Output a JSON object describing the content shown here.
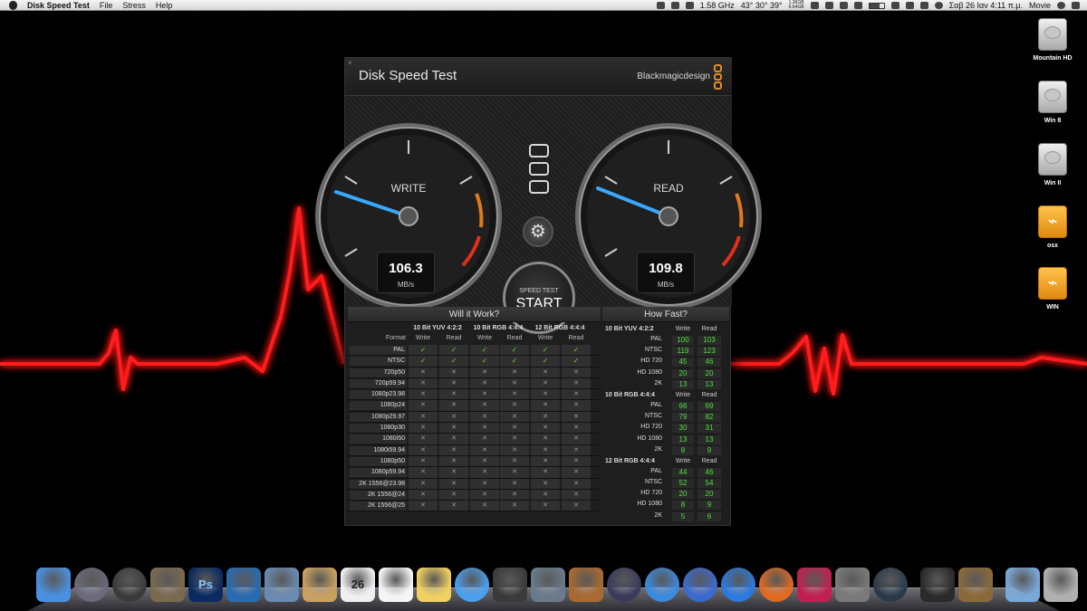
{
  "menubar": {
    "app_name": "Disk Speed Test",
    "menus": [
      "File",
      "Stress",
      "Help"
    ],
    "cpu": "1.58 GHz",
    "temps": "43° 30° 39°",
    "memory_top": "1.36GB",
    "memory_bottom": "6.64GB",
    "clock": "Σαβ 26 Ιαν  4:11 π.μ.",
    "user": "Movie"
  },
  "desktop": {
    "drives": [
      {
        "name": "Mountain HD",
        "kind": "hd"
      },
      {
        "name": "Win 8",
        "kind": "hd"
      },
      {
        "name": "Win II",
        "kind": "hd"
      },
      {
        "name": "osx",
        "kind": "usb"
      },
      {
        "name": "WIN",
        "kind": "usb"
      }
    ]
  },
  "window": {
    "title": "Disk Speed Test",
    "brand": "Blackmagicdesign"
  },
  "gauges": {
    "write": {
      "label": "WRITE",
      "value": "106.3",
      "unit": "MB/s"
    },
    "read": {
      "label": "READ",
      "value": "109.8",
      "unit": "MB/s"
    }
  },
  "start_button": {
    "small": "SPEED TEST",
    "big": "START"
  },
  "will_it_work": {
    "title": "Will it Work?",
    "format_label": "Format",
    "groups": [
      "10 Bit YUV 4:2:2",
      "10 Bit RGB 4:4:4",
      "12 Bit RGB 4:4:4"
    ],
    "subcols": [
      "Write",
      "Read",
      "Write",
      "Read",
      "Write",
      "Read"
    ],
    "rows": [
      {
        "name": "PAL",
        "cells": [
          1,
          1,
          1,
          1,
          1,
          1
        ]
      },
      {
        "name": "NTSC",
        "cells": [
          1,
          1,
          1,
          1,
          1,
          1
        ]
      },
      {
        "name": "720p50",
        "cells": [
          0,
          0,
          0,
          0,
          0,
          0
        ]
      },
      {
        "name": "720p59.94",
        "cells": [
          0,
          0,
          0,
          0,
          0,
          0
        ]
      },
      {
        "name": "1080p23.98",
        "cells": [
          0,
          0,
          0,
          0,
          0,
          0
        ]
      },
      {
        "name": "1080p24",
        "cells": [
          0,
          0,
          0,
          0,
          0,
          0
        ]
      },
      {
        "name": "1080p29.97",
        "cells": [
          0,
          0,
          0,
          0,
          0,
          0
        ]
      },
      {
        "name": "1080p30",
        "cells": [
          0,
          0,
          0,
          0,
          0,
          0
        ]
      },
      {
        "name": "1080i50",
        "cells": [
          0,
          0,
          0,
          0,
          0,
          0
        ]
      },
      {
        "name": "1080i59.94",
        "cells": [
          0,
          0,
          0,
          0,
          0,
          0
        ]
      },
      {
        "name": "1080p50",
        "cells": [
          0,
          0,
          0,
          0,
          0,
          0
        ]
      },
      {
        "name": "1080p59.94",
        "cells": [
          0,
          0,
          0,
          0,
          0,
          0
        ]
      },
      {
        "name": "2K 1556@23.98",
        "cells": [
          0,
          0,
          0,
          0,
          0,
          0
        ]
      },
      {
        "name": "2K 1556@24",
        "cells": [
          0,
          0,
          0,
          0,
          0,
          0
        ]
      },
      {
        "name": "2K 1556@25",
        "cells": [
          0,
          0,
          0,
          0,
          0,
          0
        ]
      }
    ]
  },
  "how_fast": {
    "title": "How Fast?",
    "groups": [
      {
        "name": "10 Bit YUV 4:2:2",
        "write_label": "Write",
        "read_label": "Read",
        "rows": [
          {
            "name": "PAL",
            "write": "100",
            "read": "103"
          },
          {
            "name": "NTSC",
            "write": "119",
            "read": "123"
          },
          {
            "name": "HD 720",
            "write": "45",
            "read": "46"
          },
          {
            "name": "HD 1080",
            "write": "20",
            "read": "20"
          },
          {
            "name": "2K",
            "write": "13",
            "read": "13"
          }
        ]
      },
      {
        "name": "10 Bit RGB 4:4:4",
        "write_label": "Write",
        "read_label": "Read",
        "rows": [
          {
            "name": "PAL",
            "write": "66",
            "read": "69"
          },
          {
            "name": "NTSC",
            "write": "79",
            "read": "82"
          },
          {
            "name": "HD 720",
            "write": "30",
            "read": "31"
          },
          {
            "name": "HD 1080",
            "write": "13",
            "read": "13"
          },
          {
            "name": "2K",
            "write": "8",
            "read": "9"
          }
        ]
      },
      {
        "name": "12 Bit RGB 4:4:4",
        "write_label": "Write",
        "read_label": "Read",
        "rows": [
          {
            "name": "PAL",
            "write": "44",
            "read": "46"
          },
          {
            "name": "NTSC",
            "write": "52",
            "read": "54"
          },
          {
            "name": "HD 720",
            "write": "20",
            "read": "20"
          },
          {
            "name": "HD 1080",
            "write": "8",
            "read": "9"
          },
          {
            "name": "2K",
            "write": "5",
            "read": "6"
          }
        ]
      }
    ]
  },
  "dock": {
    "calendar_day": "26",
    "photoshop_label": "Ps",
    "items": [
      {
        "name": "finder",
        "color": "#4a90e0"
      },
      {
        "name": "launchpad",
        "color": "#6a6a7a"
      },
      {
        "name": "dashboard",
        "color": "#3a3a3a"
      },
      {
        "name": "image-capture",
        "color": "#7a6a50"
      },
      {
        "name": "photoshop",
        "color": "#0a2a60"
      },
      {
        "name": "archive-utility",
        "color": "#2a6ab0"
      },
      {
        "name": "mail-stamp",
        "color": "#6a8ab0"
      },
      {
        "name": "contacts",
        "color": "#c8a060"
      },
      {
        "name": "calendar",
        "color": "#f0f0f0"
      },
      {
        "name": "reminders",
        "color": "#f4f4f4"
      },
      {
        "name": "stickies",
        "color": "#f0d060"
      },
      {
        "name": "messages",
        "color": "#4aa0f0"
      },
      {
        "name": "imovie",
        "color": "#3a3a3a"
      },
      {
        "name": "iphoto",
        "color": "#6a7a8a"
      },
      {
        "name": "keynote",
        "color": "#a86a30"
      },
      {
        "name": "quill",
        "color": "#3a3a5a"
      },
      {
        "name": "safari",
        "color": "#3a8ae0"
      },
      {
        "name": "itunes",
        "color": "#3a6ad0"
      },
      {
        "name": "app-store",
        "color": "#2a7ae0"
      },
      {
        "name": "firefox",
        "color": "#e06a20"
      },
      {
        "name": "gem-app",
        "color": "#c02050"
      },
      {
        "name": "system-preferences",
        "color": "#7a7a7a"
      },
      {
        "name": "disk-speed-test",
        "color": "#2a3a4a"
      },
      {
        "name": "activity-monitor",
        "color": "#2a2a2a"
      },
      {
        "name": "preview",
        "color": "#8a6a3a"
      },
      {
        "name": "downloads-folder",
        "color": "#7aa8d8"
      },
      {
        "name": "trash",
        "color": "#b0b0b0"
      }
    ]
  },
  "colors": {
    "wave": "#ff1a1a",
    "needle": "#3aa8ff",
    "ok": "#6fd23a",
    "speed_value": "#4ee03a",
    "brand_orange": "#e08a2a"
  }
}
